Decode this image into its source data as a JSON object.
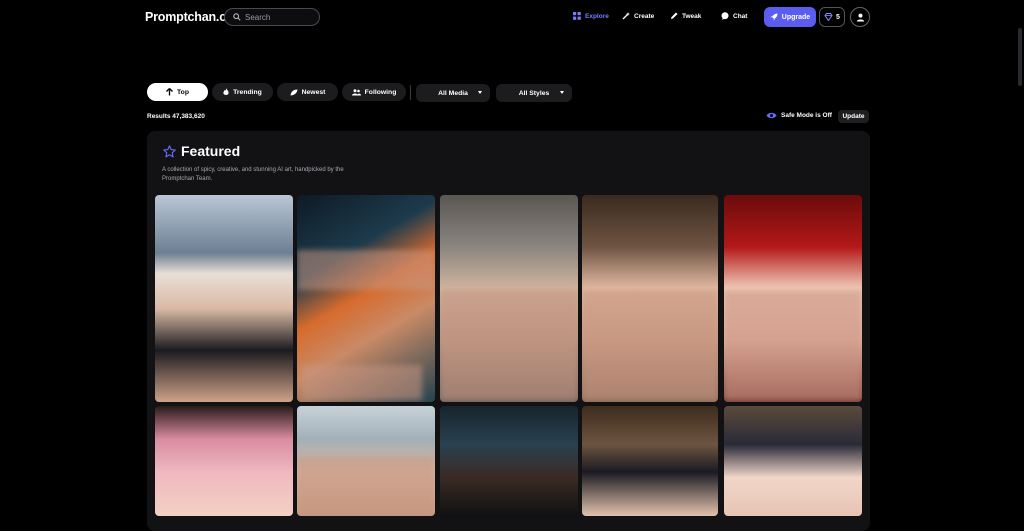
{
  "header": {
    "logo": "Promptchan.com",
    "search_placeholder": "Search",
    "nav": [
      {
        "label": "Explore",
        "icon": "grid-icon",
        "active": true
      },
      {
        "label": "Create",
        "icon": "wand-icon",
        "active": false
      },
      {
        "label": "Tweak",
        "icon": "pencil-icon",
        "active": false
      },
      {
        "label": "Chat",
        "icon": "chat-bubble-icon",
        "active": false
      }
    ],
    "upgrade_label": "Upgrade",
    "gems_count": "5",
    "accent_color": "#5b5cf0"
  },
  "filters": {
    "tabs": [
      {
        "label": "Top",
        "icon": "arrow-up-icon",
        "active": true
      },
      {
        "label": "Trending",
        "icon": "flame-icon",
        "active": false
      },
      {
        "label": "Newest",
        "icon": "leaf-icon",
        "active": false
      },
      {
        "label": "Following",
        "icon": "users-icon",
        "active": false
      }
    ],
    "media_select": "All Media",
    "styles_select": "All Styles"
  },
  "results_text": "Results 47,383,620",
  "safe_mode_text": "Safe Mode is Off",
  "update_label": "Update",
  "featured": {
    "title": "Featured",
    "description": "A collection of spicy, creative, and stunning AI art, handpicked by the Promptchan Team."
  },
  "gallery": {
    "tile_count": 10
  }
}
